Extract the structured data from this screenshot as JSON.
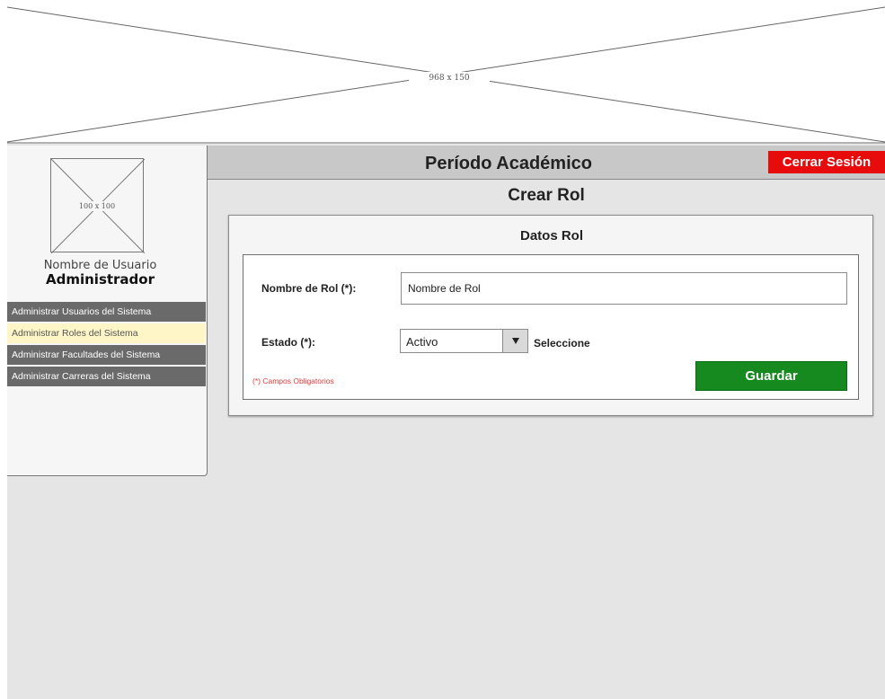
{
  "banner": {
    "placeholder_label": "968 x 150"
  },
  "sidebar": {
    "avatar_label": "100 x 100",
    "user_name": "Nombre de Usuario",
    "user_role": "Administrador",
    "menu": [
      {
        "label": "Administrar Usuarios del Sistema",
        "active": false
      },
      {
        "label": "Administrar Roles del Sistema",
        "active": true
      },
      {
        "label": "Administrar Facultades del Sistema",
        "active": false
      },
      {
        "label": "Administrar Carreras del Sistema",
        "active": false
      }
    ]
  },
  "header": {
    "title": "Período Académico",
    "logout_label": "Cerrar Sesión"
  },
  "main": {
    "section_title": "Crear Rol",
    "panel_title": "Datos Rol",
    "form": {
      "role_name_label": "Nombre de Rol (*):",
      "role_name_value": "Nombre de Rol",
      "status_label": "Estado (*):",
      "status_value": "Activo",
      "status_hint": "Seleccione",
      "required_note": "(*) Campos Obligatorios",
      "save_label": "Guardar"
    }
  },
  "colors": {
    "logout_bg": "#e80b0b",
    "save_bg": "#178a1f",
    "active_menu_bg": "#fff6c7",
    "menu_bg": "#6a6a6a"
  }
}
